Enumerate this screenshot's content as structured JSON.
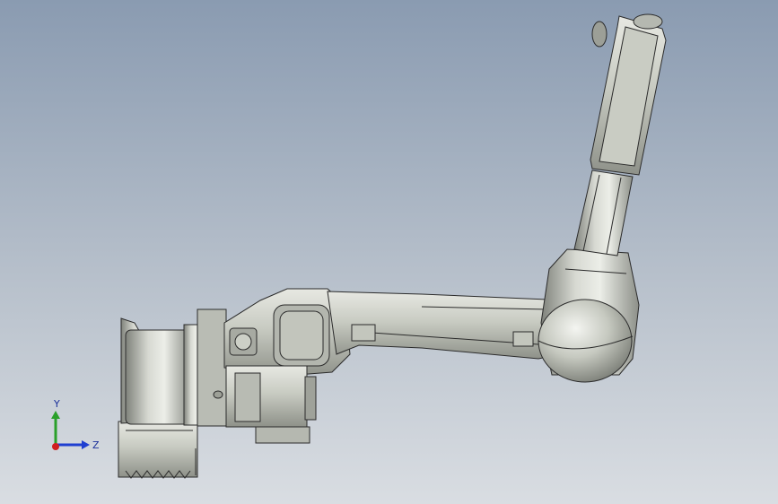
{
  "viewport": {
    "background_top": "#8a9bb1",
    "background_bottom": "#d9dde2"
  },
  "model": {
    "body_color": "#c9cbc4",
    "shadow_color": "#8f928a",
    "line_color": "#2b2b2b"
  },
  "triad": {
    "y_label": "Y",
    "z_label": "Z",
    "y_color": "#2aa02a",
    "z_color": "#1f3fd1",
    "x_color": "#d11f1f"
  }
}
